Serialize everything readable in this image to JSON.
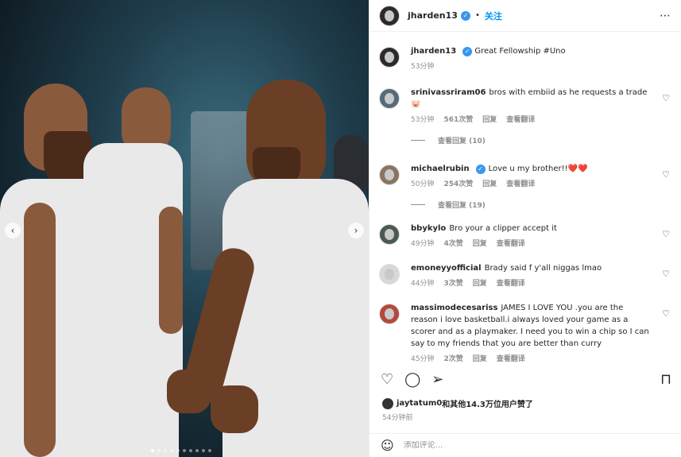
{
  "header": {
    "username": "jharden13",
    "follow_label": "关注",
    "more_icon": "more-horizontal-icon"
  },
  "caption": {
    "username": "jharden13",
    "text": "Great Fellowship #Uno",
    "time": "53分钟"
  },
  "comments": [
    {
      "username": "srinivassriram06",
      "text": "bros with embiid as he requests a trade 🐷",
      "time": "53分钟",
      "likes": "561次赞",
      "reply": "回复",
      "translate": "查看翻译",
      "replies_label": "查看回复 (10)"
    },
    {
      "username": "michaelrubin",
      "verified": true,
      "text": "Love u my brother!!❤️❤️",
      "time": "50分钟",
      "likes": "254次赞",
      "reply": "回复",
      "translate": "查看翻译",
      "replies_label": "查看回复 (19)"
    },
    {
      "username": "bbykylo",
      "text": "Bro your a clipper accept it",
      "time": "49分钟",
      "likes": "4次赞",
      "reply": "回复",
      "translate": "查看翻译"
    },
    {
      "username": "emoneyyofficial",
      "text": "Brady said f y'all niggas lmao",
      "time": "44分钟",
      "likes": "3次赞",
      "reply": "回复",
      "translate": "查看翻译"
    },
    {
      "username": "massimodecesariss",
      "text": "JAMES I LOVE YOU .you are the reason i love basketball.i always loved your game as a scorer and as a playmaker. I need you to win a chip so I can say to my friends that you are better than curry",
      "time": "45分钟",
      "likes": "2次赞",
      "reply": "回复",
      "translate": "查看翻译"
    }
  ],
  "likes": {
    "user": "jaytatum0",
    "rest": "和其他14.3万位用户赞了"
  },
  "post_time": "54分钟前",
  "add_comment": {
    "placeholder": "添加评论..."
  },
  "colors": {
    "link": "#0095f6",
    "verified": "#3897f0",
    "muted": "#8e8e8e"
  }
}
